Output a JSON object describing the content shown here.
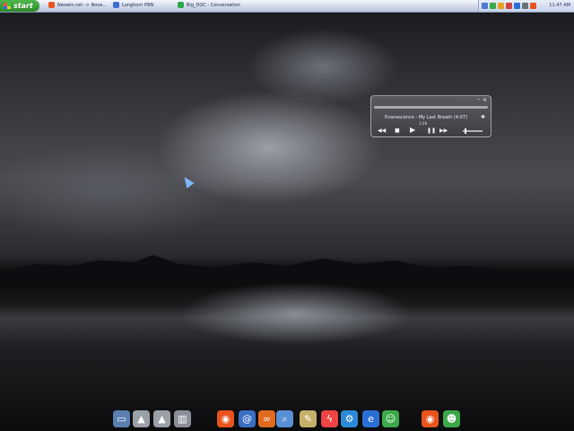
{
  "taskbar": {
    "start_label": "start",
    "tasks": [
      {
        "label": "Neowin.net -> Nove...",
        "icon": "firefox-icon",
        "color": "#e8541d"
      },
      {
        "label": "Longhorn PBN",
        "icon": "browser-icon",
        "color": "#3d6fd8"
      },
      {
        "label": "Big_DOC - Conversation",
        "icon": "msn-icon",
        "color": "#2aa84a"
      }
    ],
    "clock": "11:47 AM"
  },
  "player": {
    "track": "Evanescence - My Last Breath (4:07)",
    "time": "1:28",
    "controls": [
      "rewind",
      "stop",
      "play",
      "pause",
      "forward"
    ]
  },
  "dock": {
    "items": [
      {
        "name": "laptop-icon",
        "color": "#5a7fb0",
        "glyph": "▭"
      },
      {
        "name": "drive-icon-1",
        "color": "#9aa0a8",
        "glyph": "▲"
      },
      {
        "name": "drive-icon-2",
        "color": "#9aa0a8",
        "glyph": "▲"
      },
      {
        "name": "trash-icon",
        "color": "#8a8f98",
        "glyph": "▥"
      },
      {
        "name": "firefox-icon",
        "color": "#e8541d",
        "glyph": "◉"
      },
      {
        "name": "mail-icon",
        "color": "#3b6fc4",
        "glyph": "@"
      },
      {
        "name": "rss-icon",
        "color": "#e06a1e",
        "glyph": "∞"
      },
      {
        "name": "search-icon",
        "color": "#5a8fd6",
        "glyph": "⌕"
      },
      {
        "name": "notes-icon",
        "color": "#c7b06a",
        "glyph": "✎"
      },
      {
        "name": "lightning-icon",
        "color": "#e44",
        "glyph": "ϟ"
      },
      {
        "name": "gear-icon",
        "color": "#2c8ad8",
        "glyph": "⚙"
      },
      {
        "name": "ie-icon",
        "color": "#2a6fd6",
        "glyph": "e"
      },
      {
        "name": "msn-icon",
        "color": "#3ba84a",
        "glyph": "☺"
      },
      {
        "name": "firefox-icon-2",
        "color": "#e8541d",
        "glyph": "◉"
      },
      {
        "name": "users-icon",
        "color": "#3ba84a",
        "glyph": "☻"
      }
    ]
  }
}
